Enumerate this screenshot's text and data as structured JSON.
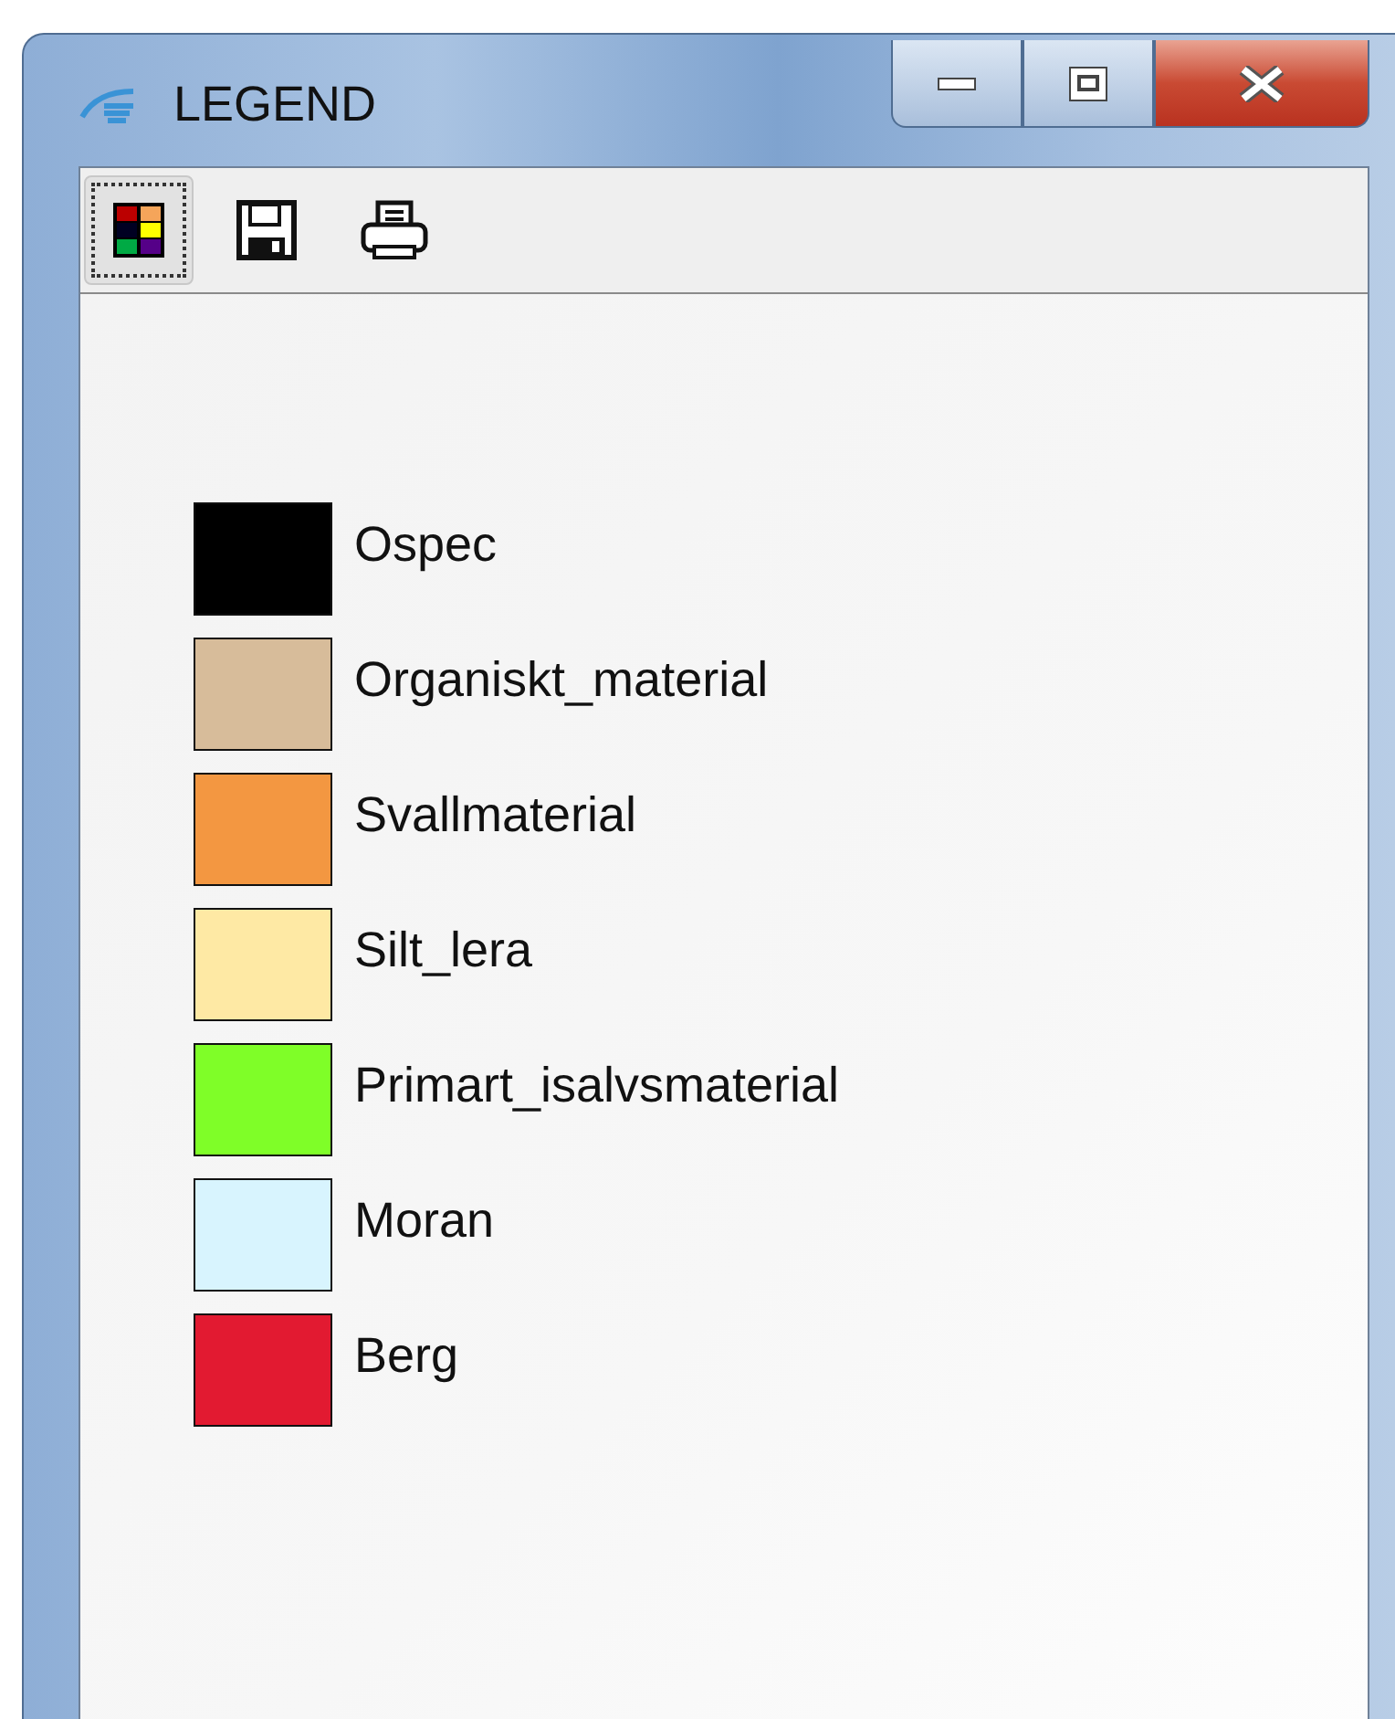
{
  "window": {
    "title": "LEGEND"
  },
  "toolbar": [
    {
      "kind": "legend",
      "selected": true
    },
    {
      "kind": "save",
      "selected": false
    },
    {
      "kind": "print",
      "selected": false
    }
  ],
  "legend": [
    {
      "label": "Ospec",
      "color": "#000000"
    },
    {
      "label": "Organiskt_material",
      "color": "#d7bc9a"
    },
    {
      "label": "Svallmaterial",
      "color": "#f39741"
    },
    {
      "label": "Silt_lera",
      "color": "#fee9a4"
    },
    {
      "label": "Primart_isalvsmaterial",
      "color": "#7ffe28"
    },
    {
      "label": "Moran",
      "color": "#d8f4fe"
    },
    {
      "label": "Berg",
      "color": "#e21a31"
    }
  ]
}
